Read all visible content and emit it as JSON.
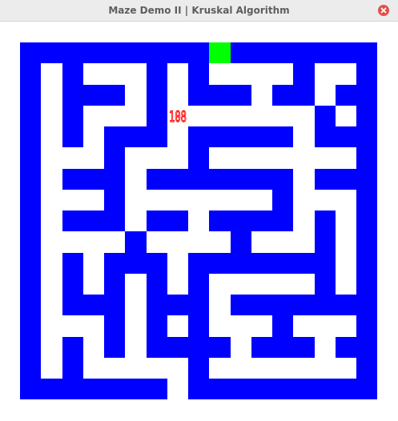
{
  "window": {
    "title": "Maze Demo II | Kruskal Algorithm",
    "close_icon": "close-icon"
  },
  "maze": {
    "cols": 17,
    "rows": 17,
    "wall_color": "#0000ff",
    "path_color": "#ffffff",
    "start_color": "#00ff00",
    "counter_color": "#ff0000",
    "counter": "108",
    "start_cell": [
      9,
      0
    ],
    "exit_cell": [
      7,
      16
    ],
    "counter_cell": [
      7,
      3
    ],
    "walls": [
      "WWWWWWWWWWWWWWWWW",
      "WOWOOOWOWOOOOWOOW",
      "WOWWWOWOWWWOWWOWW",
      "WOWOOOWOOOOOOOWOW",
      "WOWOWWWOWWWWWOWWW",
      "WOOOWOOOWOOOOOOOW",
      "WOWWWOWWWWWWWOWWW",
      "WOOOWOOOOOOOWOOOW",
      "WOWWWOWWOWWWWOWOW",
      "WOOOOWOOOOWOOOWOW",
      "WOWOWWWOWWWWWWWOW",
      "WOWOWOWOWOOOOOWOW",
      "WOWWWOWWWOWWWWWWW",
      "WOOOWOWOWOOOWOOOW",
      "WOWOWOWWWWOWWWOWW",
      "WOWOOOOOWOOOOOOOW",
      "WWWWWWWOWWWWWWWWW"
    ]
  }
}
